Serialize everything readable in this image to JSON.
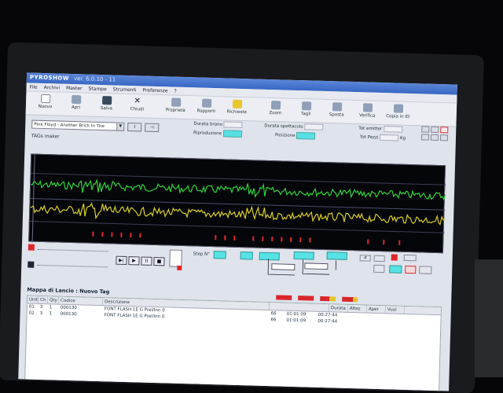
{
  "window": {
    "title": "PYROSHOW",
    "version": "ver. 6.0.10 - 11"
  },
  "menu": [
    "File",
    "Archivi",
    "Master",
    "Stampe",
    "Strumenti",
    "Preferenze",
    "?"
  ],
  "toolbar": [
    {
      "label": "Nuovo",
      "icon": "doc-icon"
    },
    {
      "label": "Apri",
      "icon": "folder-icon"
    },
    {
      "label": "Salva",
      "icon": "save-icon"
    },
    {
      "label": "Chiudi",
      "icon": "close-icon"
    },
    {
      "label": "Proprietà",
      "icon": "properties-icon"
    },
    {
      "label": "Rapporti",
      "icon": "report-icon"
    },
    {
      "label": "Richieste",
      "icon": "request-icon"
    },
    {
      "label": "Zoom",
      "icon": "zoom-icon"
    },
    {
      "label": "Tagli",
      "icon": "cut-icon"
    },
    {
      "label": "Sposta",
      "icon": "move-icon"
    },
    {
      "label": "Verifica",
      "icon": "verify-icon"
    },
    {
      "label": "Copia in ID",
      "icon": "copy-icon"
    }
  ],
  "controls": {
    "track": "Pink Floyd - Another Brick In The",
    "durata_brano_label": "Durata brano",
    "riproduzione_label": "Riproduzione",
    "durata_spettacolo_label": "Durata spettacolo",
    "posizione_label": "Posizione",
    "tot_emitter_label": "Tot emitter",
    "tot_pezzi_label": "Tot Pezzi",
    "kg_label": "Kg"
  },
  "tagmaker_label": "TAGs maker",
  "transport": {
    "step_label": "Step N°"
  },
  "map": {
    "title": "Mappa di Lancio : Nuovo Tag",
    "columns": [
      "Unit",
      "Ch",
      "Qty",
      "Codice",
      "Descrizione"
    ],
    "rows": [
      {
        "unit": "01",
        "ch": "3",
        "qty": "1",
        "codice": "000130",
        "descrizione": "FONT FLASH 1E G Prel/Inn 0"
      },
      {
        "unit": "02",
        "ch": "3",
        "qty": "1",
        "codice": "000130",
        "descrizione": "FONT FLASH 1E G Prel/Inn 0"
      }
    ],
    "right_columns": [
      "Durata",
      "Altez",
      "Aper",
      "Vuoi"
    ],
    "times": [
      {
        "a": "66",
        "b": "01:01:09",
        "c": "00:27:44"
      },
      {
        "a": "66",
        "b": "01:01:09",
        "c": "00:27:44"
      }
    ]
  },
  "colors": {
    "wave_top": "#2fd33a",
    "wave_bottom": "#d9cf22",
    "tag_marks": "#e0262a",
    "cyan": "#57e3e6"
  }
}
